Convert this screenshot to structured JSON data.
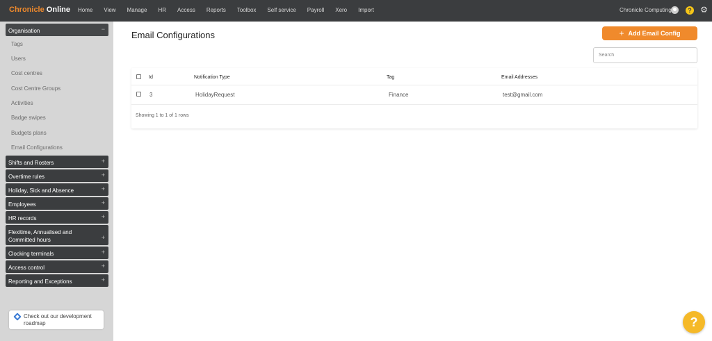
{
  "brand": {
    "part1": "Chronicle",
    "part2": "Online"
  },
  "nav": [
    "Home",
    "View",
    "Manage",
    "HR",
    "Access",
    "Reports",
    "Toolbox",
    "Self service",
    "Payroll",
    "Xero",
    "Import"
  ],
  "user": {
    "name": "Chronicle Computing",
    "help_glyph": "?",
    "settings_glyph": "⚙"
  },
  "sidebar": {
    "active_group": "Organisation",
    "sub_items": [
      "Tags",
      "Users",
      "Cost centres",
      "Cost Centre Groups",
      "Activities",
      "Badge swipes",
      "Budgets plans",
      "Email Configurations"
    ],
    "groups": [
      "Shifts and Rosters",
      "Overtime rules",
      "Holiday, Sick and Absence",
      "Employees",
      "HR records",
      "Flexitime, Annualised and Committed hours",
      "Clocking terminals",
      "Access control",
      "Reporting and Exceptions"
    ],
    "collapse_glyph": "−",
    "expand_glyph": "+"
  },
  "roadmap": {
    "text": "Check out our development roadmap"
  },
  "main": {
    "title": "Email Configurations",
    "add_button": "Add Email Config",
    "add_glyph": "+",
    "search_placeholder": "Search",
    "columns": [
      "Id",
      "Notification Type",
      "Tag",
      "Email Addresses"
    ],
    "rows": [
      {
        "id": "3",
        "notification_type": "HolidayRequest",
        "tag": "Finance",
        "email": "test@gmail.com"
      }
    ],
    "footer": "Showing 1 to 1 of 1 rows"
  },
  "fab": {
    "glyph": "?"
  },
  "colors": {
    "accent": "#f08a2c",
    "topbar": "#3b3d3f",
    "sidebar": "#d6d6d6",
    "help": "#f5b928"
  }
}
